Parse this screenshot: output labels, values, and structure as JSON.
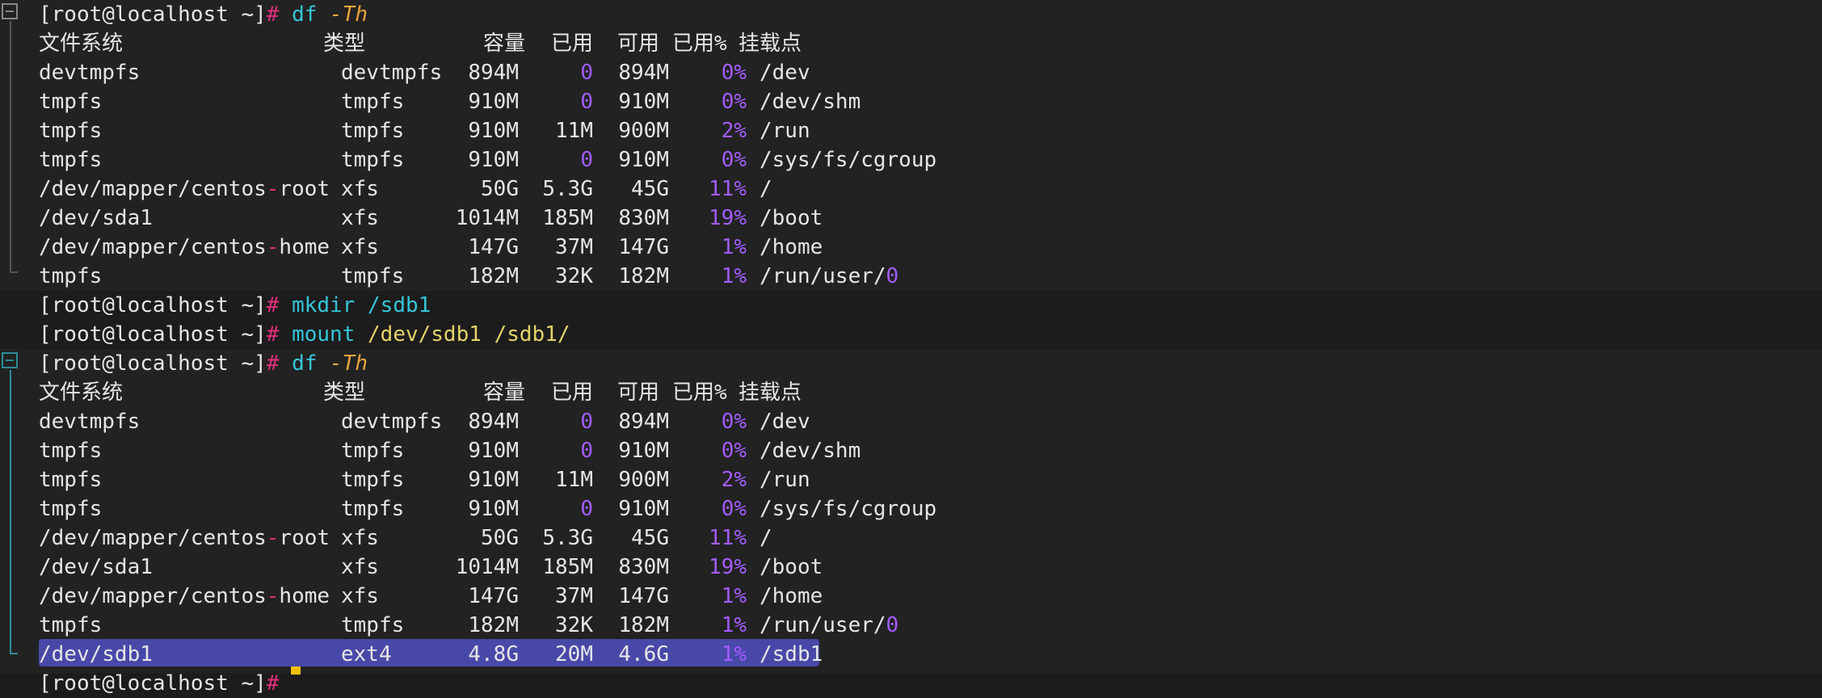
{
  "prompt": "[root@localhost ~]",
  "hash": "#",
  "commands": {
    "df": "df",
    "df_flag": "-Th",
    "mkdir": "mkdir",
    "mkdir_arg": "/sdb1",
    "mount": "mount",
    "mount_arg1": "/dev/sdb1",
    "mount_arg2": "/sdb1/"
  },
  "table_headers": {
    "fs": "文件系统",
    "type": "类型",
    "size": "容量",
    "used": "已用",
    "avail": "可用",
    "pct": "已用%",
    "mount": "挂载点"
  },
  "first_table": [
    {
      "fs": "devtmpfs",
      "type": "devtmpfs",
      "size": "894M",
      "used": "0",
      "avail": "894M",
      "pct": "0%",
      "mount": "/dev"
    },
    {
      "fs": "tmpfs",
      "type": "tmpfs",
      "size": "910M",
      "used": "0",
      "avail": "910M",
      "pct": "0%",
      "mount": "/dev/shm"
    },
    {
      "fs": "tmpfs",
      "type": "tmpfs",
      "size": "910M",
      "used": "11M",
      "avail": "900M",
      "pct": "2%",
      "mount": "/run"
    },
    {
      "fs": "tmpfs",
      "type": "tmpfs",
      "size": "910M",
      "used": "0",
      "avail": "910M",
      "pct": "0%",
      "mount": "/sys/fs/cgroup"
    },
    {
      "fs": "/dev/mapper/centos-root",
      "type": "xfs",
      "size": "50G",
      "used": "5.3G",
      "avail": "45G",
      "pct": "11%",
      "mount": "/"
    },
    {
      "fs": "/dev/sda1",
      "type": "xfs",
      "size": "1014M",
      "used": "185M",
      "avail": "830M",
      "pct": "19%",
      "mount": "/boot"
    },
    {
      "fs": "/dev/mapper/centos-home",
      "type": "xfs",
      "size": "147G",
      "used": "37M",
      "avail": "147G",
      "pct": "1%",
      "mount": "/home"
    },
    {
      "fs": "tmpfs",
      "type": "tmpfs",
      "size": "182M",
      "used": "32K",
      "avail": "182M",
      "pct": "1%",
      "mount": "/run/user/0"
    }
  ],
  "second_table": [
    {
      "fs": "devtmpfs",
      "type": "devtmpfs",
      "size": "894M",
      "used": "0",
      "avail": "894M",
      "pct": "0%",
      "mount": "/dev"
    },
    {
      "fs": "tmpfs",
      "type": "tmpfs",
      "size": "910M",
      "used": "0",
      "avail": "910M",
      "pct": "0%",
      "mount": "/dev/shm"
    },
    {
      "fs": "tmpfs",
      "type": "tmpfs",
      "size": "910M",
      "used": "11M",
      "avail": "900M",
      "pct": "2%",
      "mount": "/run"
    },
    {
      "fs": "tmpfs",
      "type": "tmpfs",
      "size": "910M",
      "used": "0",
      "avail": "910M",
      "pct": "0%",
      "mount": "/sys/fs/cgroup"
    },
    {
      "fs": "/dev/mapper/centos-root",
      "type": "xfs",
      "size": "50G",
      "used": "5.3G",
      "avail": "45G",
      "pct": "11%",
      "mount": "/"
    },
    {
      "fs": "/dev/sda1",
      "type": "xfs",
      "size": "1014M",
      "used": "185M",
      "avail": "830M",
      "pct": "19%",
      "mount": "/boot"
    },
    {
      "fs": "/dev/mapper/centos-home",
      "type": "xfs",
      "size": "147G",
      "used": "37M",
      "avail": "147G",
      "pct": "1%",
      "mount": "/home"
    },
    {
      "fs": "tmpfs",
      "type": "tmpfs",
      "size": "182M",
      "used": "32K",
      "avail": "182M",
      "pct": "1%",
      "mount": "/run/user/0"
    },
    {
      "fs": "/dev/sdb1",
      "type": "ext4",
      "size": "4.8G",
      "used": "20M",
      "avail": "4.6G",
      "pct": "1%",
      "mount": "/sdb1"
    }
  ],
  "colors": {
    "background": "#1c1c1c",
    "block_background": "#222222",
    "hash": "#e0307a",
    "command": "#36c5d8",
    "flag": "#e8a33c",
    "number": "#a35cff",
    "path_arg": "#e3d36a",
    "selection": "#4848a8",
    "cursor": "#f2c200"
  }
}
